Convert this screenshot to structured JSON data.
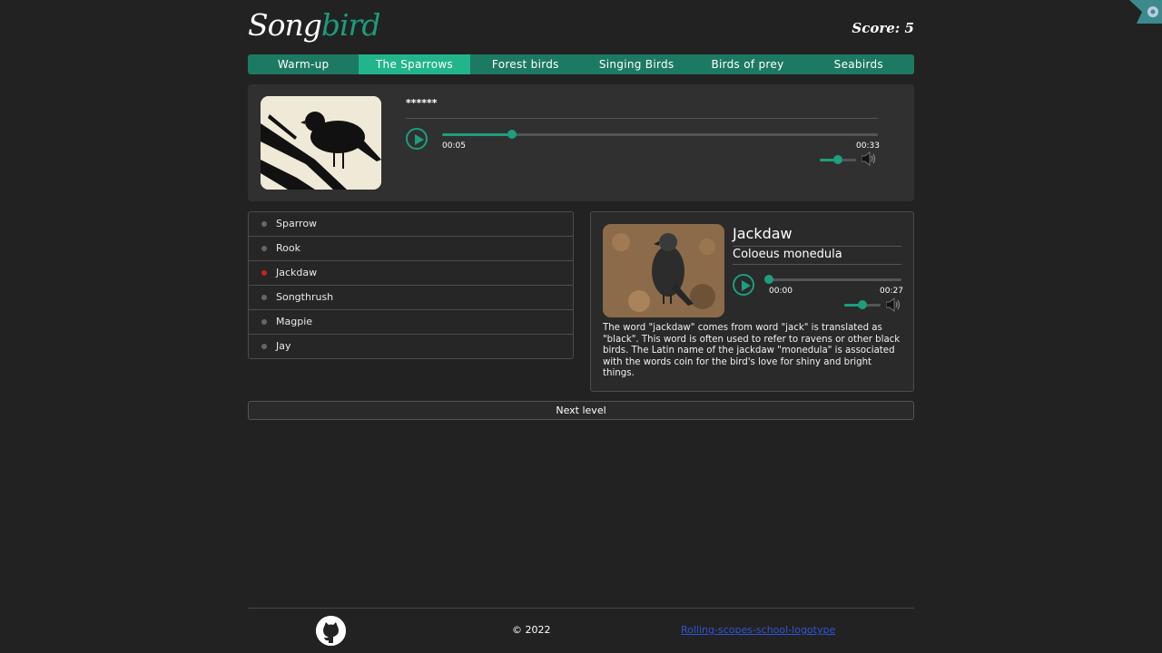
{
  "header": {
    "logo_white": "Song",
    "logo_green": "bird",
    "score": "Score: 5"
  },
  "nav": {
    "items": [
      {
        "label": "Warm-up",
        "active": false
      },
      {
        "label": "The Sparrows",
        "active": true
      },
      {
        "label": "Forest birds",
        "active": false
      },
      {
        "label": "Singing Birds",
        "active": false
      },
      {
        "label": "Birds of prey",
        "active": false
      },
      {
        "label": "Seabirds",
        "active": false
      }
    ]
  },
  "question": {
    "hidden_name": "******",
    "player": {
      "current_time": "00:05",
      "duration": "00:33",
      "progress": 0.16,
      "volume": 0.5
    }
  },
  "answers": [
    {
      "label": "Sparrow",
      "state": "neutral"
    },
    {
      "label": "Rook",
      "state": "neutral"
    },
    {
      "label": "Jackdaw",
      "state": "wrong"
    },
    {
      "label": "Songthrush",
      "state": "neutral"
    },
    {
      "label": "Magpie",
      "state": "neutral"
    },
    {
      "label": "Jay",
      "state": "neutral"
    }
  ],
  "info": {
    "name": "Jackdaw",
    "latin": "Coloeus monedula",
    "player": {
      "current_time": "00:00",
      "duration": "00:27",
      "progress": 0.0,
      "volume": 0.5
    },
    "description": "The word \"jackdaw\" comes from word \"jack\" is translated as \"black\". This word is often used to refer to ravens or other black birds. The Latin name of the jackdaw \"monedula\" is associated with the words coin for the bird's love for shiny and bright things."
  },
  "next_button": "Next level",
  "footer": {
    "copyright": "© 2022",
    "rss_alt": "Rolling-scopes-school-logotype"
  },
  "colors": {
    "accent": "#1d9e7e",
    "nav_bg": "#1d7a62",
    "nav_active": "#22b58b",
    "wrong": "#c0281d",
    "background": "#222222"
  },
  "icons": {
    "settings": "gear-icon",
    "github": "github-icon",
    "play": "play-icon",
    "volume": "speaker-icon"
  }
}
